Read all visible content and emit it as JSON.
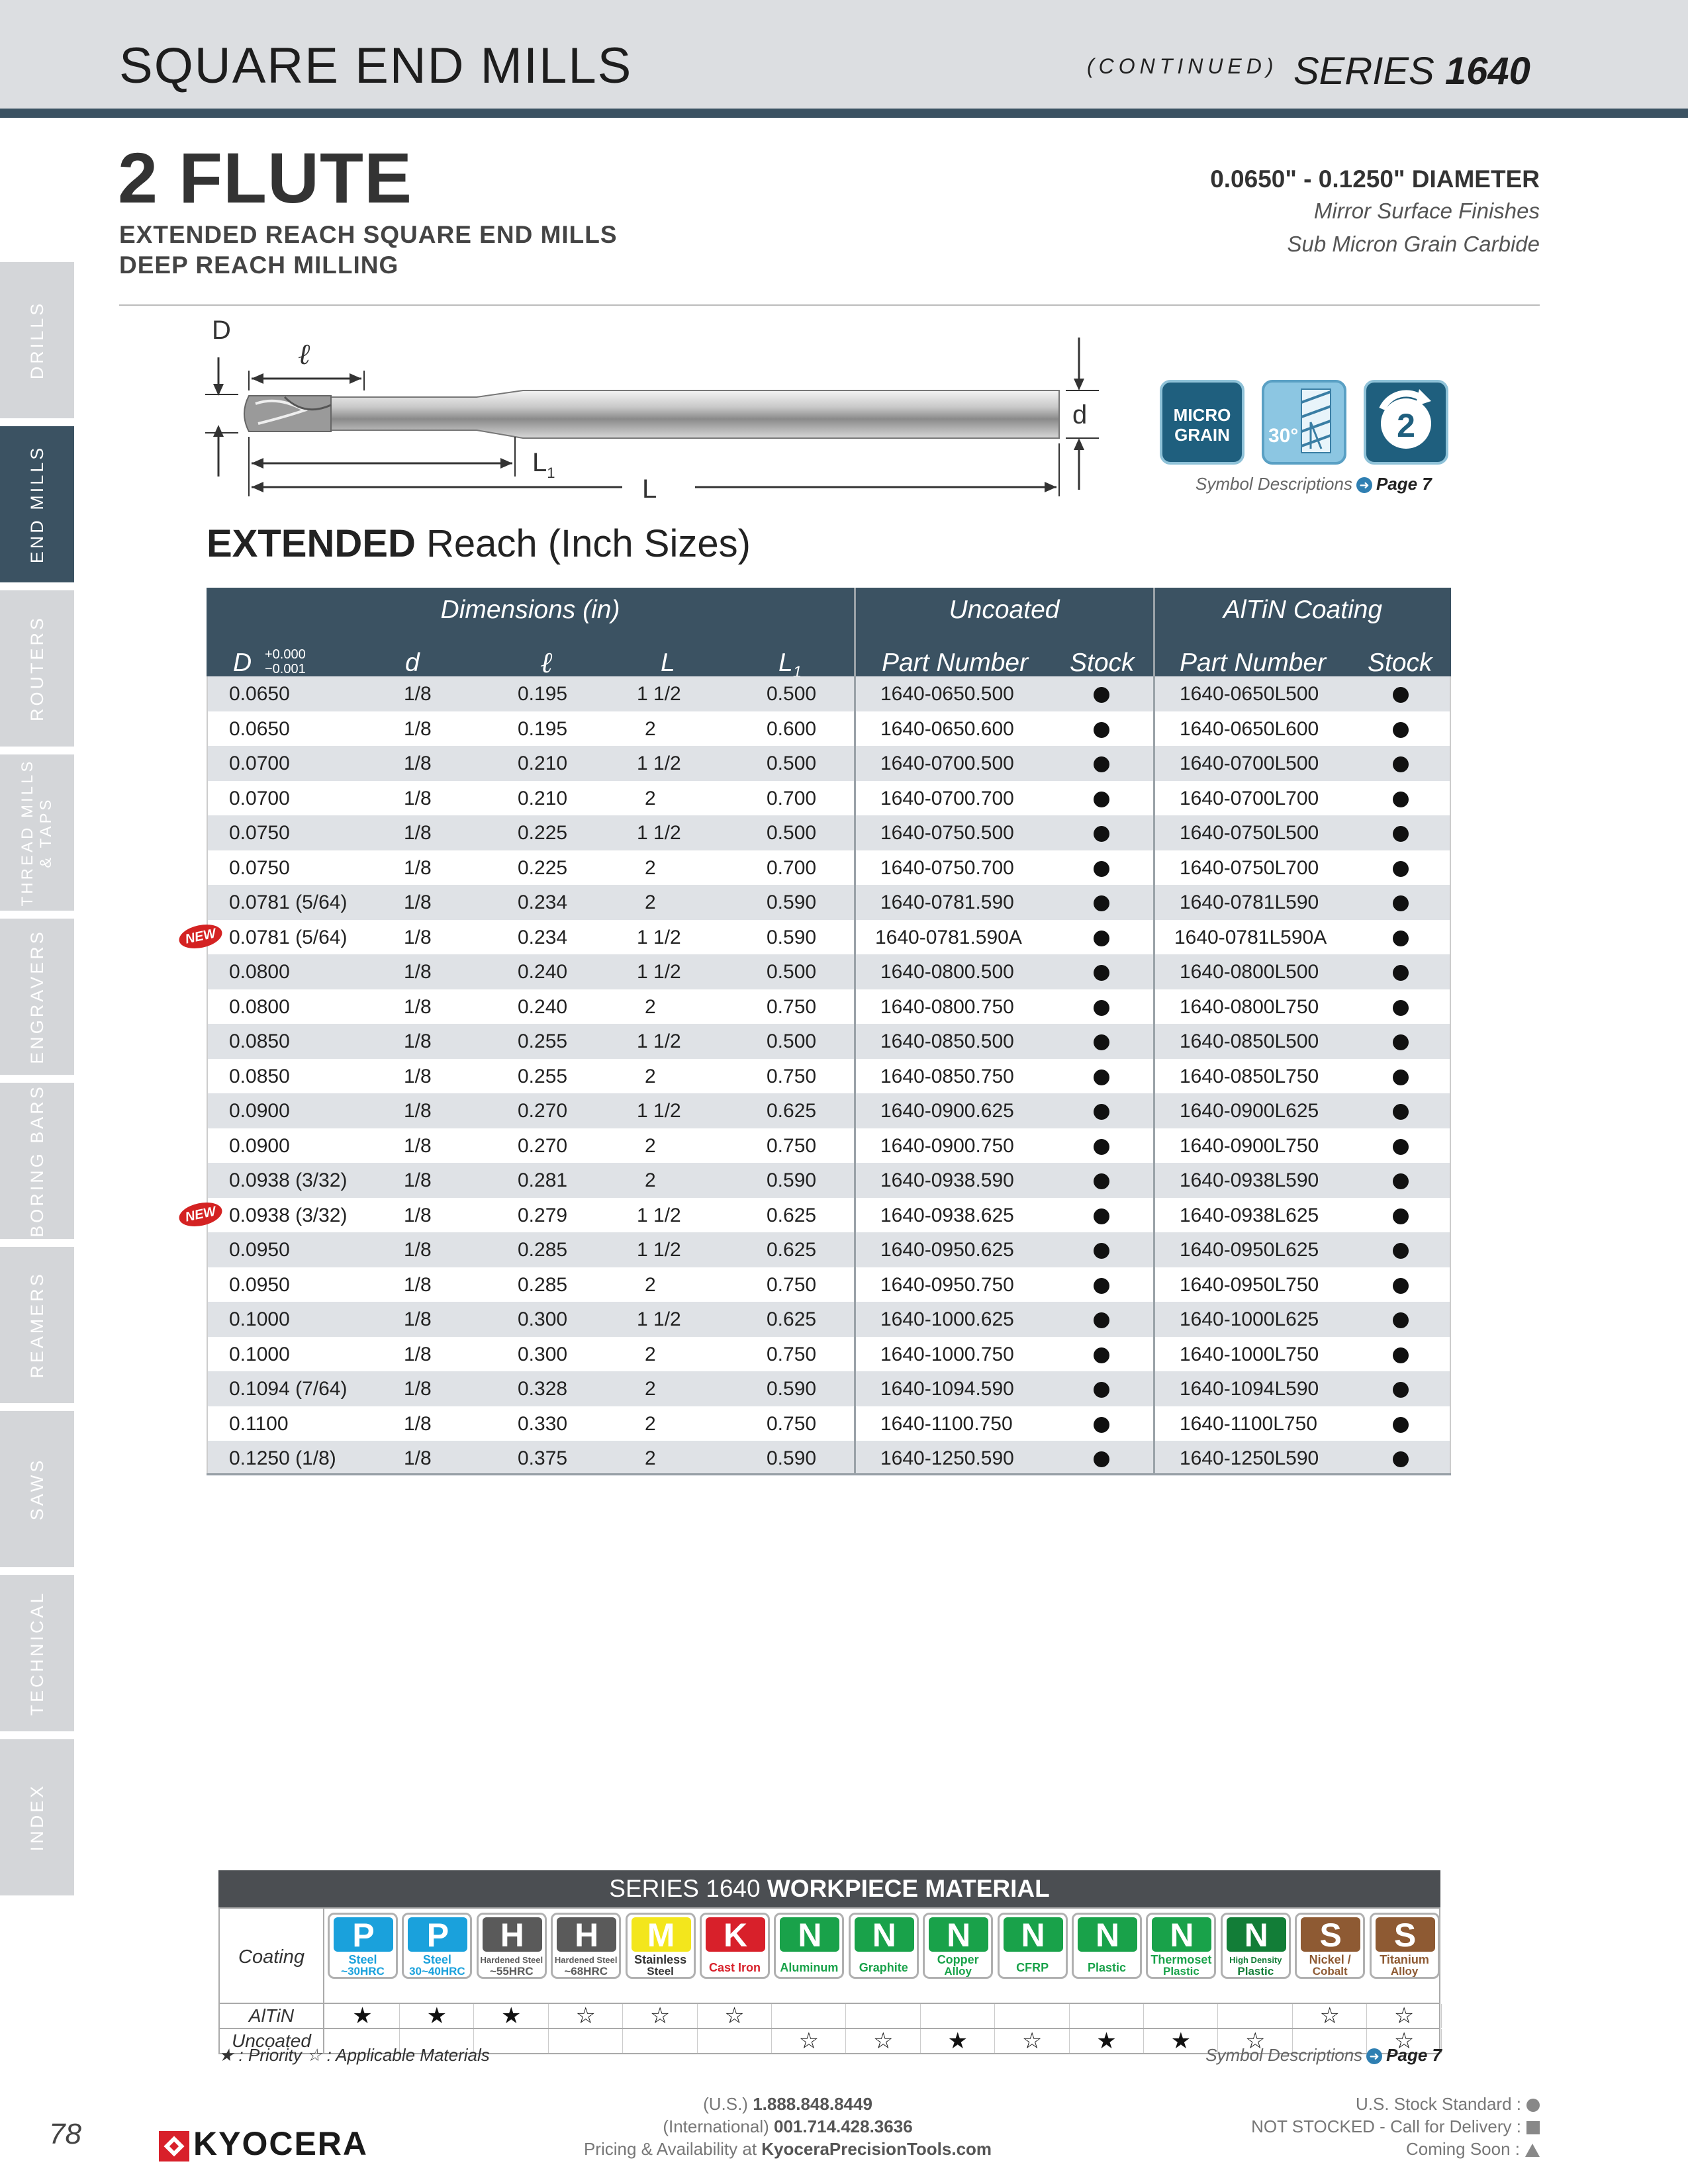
{
  "header": {
    "title": "SQUARE END MILLS",
    "continued": "(CONTINUED)",
    "series_label": "SERIES",
    "series_number": "1640"
  },
  "side_tabs": [
    {
      "label": "DRILLS",
      "active": false
    },
    {
      "label": "END MILLS",
      "active": true
    },
    {
      "label": "ROUTERS",
      "active": false
    },
    {
      "label": "THREAD MILLS & TAPS",
      "active": false
    },
    {
      "label": "ENGRAVERS",
      "active": false
    },
    {
      "label": "BORING BARS",
      "active": false
    },
    {
      "label": "REAMERS",
      "active": false
    },
    {
      "label": "SAWS",
      "active": false
    },
    {
      "label": "TECHNICAL",
      "active": false
    },
    {
      "label": "INDEX",
      "active": false
    }
  ],
  "product": {
    "flute_title": "2 FLUTE",
    "subtitle_1": "EXTENDED REACH SQUARE END MILLS",
    "subtitle_2": "DEEP REACH MILLING",
    "diameter_range": "0.0650\" - 0.1250\" DIAMETER",
    "finish_1": "Mirror Surface Finishes",
    "finish_2": "Sub Micron Grain Carbide"
  },
  "diagram": {
    "label_D": "D",
    "label_l": "ℓ",
    "label_d": "d",
    "label_L1": "L",
    "label_L1_sub": "1",
    "label_L": "L"
  },
  "badges": {
    "micro_grain_1": "MICRO",
    "micro_grain_2": "GRAIN",
    "helix": "30°",
    "flutes": "2",
    "symbol_desc": "Symbol Descriptions",
    "page_ref": "Page 7"
  },
  "table_title": {
    "bold": "EXTENDED",
    "rest": " Reach (Inch Sizes)"
  },
  "table": {
    "group_headers": [
      "Dimensions (in)",
      "Uncoated",
      "AlTiN Coating"
    ],
    "col_D": "D",
    "tol_plus": "+0.000",
    "tol_minus": "−0.001",
    "col_d": "d",
    "col_l": "ℓ",
    "col_L": "L",
    "col_L1": "L",
    "col_L1_sub": "1",
    "col_pn": "Part Number",
    "col_stock": "Stock",
    "col_pn2": "Part Number",
    "col_stock2": "Stock",
    "new_label": "NEW",
    "rows": [
      {
        "D": "0.0650",
        "d": "1/8",
        "l": "0.195",
        "L": "1 1/2",
        "L1": "0.500",
        "pn": "1640-0650.500",
        "pn2": "1640-0650L500",
        "new": false
      },
      {
        "D": "0.0650",
        "d": "1/8",
        "l": "0.195",
        "L": "2",
        "L1": "0.600",
        "pn": "1640-0650.600",
        "pn2": "1640-0650L600",
        "new": false
      },
      {
        "D": "0.0700",
        "d": "1/8",
        "l": "0.210",
        "L": "1 1/2",
        "L1": "0.500",
        "pn": "1640-0700.500",
        "pn2": "1640-0700L500",
        "new": false
      },
      {
        "D": "0.0700",
        "d": "1/8",
        "l": "0.210",
        "L": "2",
        "L1": "0.700",
        "pn": "1640-0700.700",
        "pn2": "1640-0700L700",
        "new": false
      },
      {
        "D": "0.0750",
        "d": "1/8",
        "l": "0.225",
        "L": "1 1/2",
        "L1": "0.500",
        "pn": "1640-0750.500",
        "pn2": "1640-0750L500",
        "new": false
      },
      {
        "D": "0.0750",
        "d": "1/8",
        "l": "0.225",
        "L": "2",
        "L1": "0.700",
        "pn": "1640-0750.700",
        "pn2": "1640-0750L700",
        "new": false
      },
      {
        "D": "0.0781 (5/64)",
        "d": "1/8",
        "l": "0.234",
        "L": "2",
        "L1": "0.590",
        "pn": "1640-0781.590",
        "pn2": "1640-0781L590",
        "new": false
      },
      {
        "D": "0.0781 (5/64)",
        "d": "1/8",
        "l": "0.234",
        "L": "1 1/2",
        "L1": "0.590",
        "pn": "1640-0781.590A",
        "pn2": "1640-0781L590A",
        "new": true
      },
      {
        "D": "0.0800",
        "d": "1/8",
        "l": "0.240",
        "L": "1 1/2",
        "L1": "0.500",
        "pn": "1640-0800.500",
        "pn2": "1640-0800L500",
        "new": false
      },
      {
        "D": "0.0800",
        "d": "1/8",
        "l": "0.240",
        "L": "2",
        "L1": "0.750",
        "pn": "1640-0800.750",
        "pn2": "1640-0800L750",
        "new": false
      },
      {
        "D": "0.0850",
        "d": "1/8",
        "l": "0.255",
        "L": "1 1/2",
        "L1": "0.500",
        "pn": "1640-0850.500",
        "pn2": "1640-0850L500",
        "new": false
      },
      {
        "D": "0.0850",
        "d": "1/8",
        "l": "0.255",
        "L": "2",
        "L1": "0.750",
        "pn": "1640-0850.750",
        "pn2": "1640-0850L750",
        "new": false
      },
      {
        "D": "0.0900",
        "d": "1/8",
        "l": "0.270",
        "L": "1 1/2",
        "L1": "0.625",
        "pn": "1640-0900.625",
        "pn2": "1640-0900L625",
        "new": false
      },
      {
        "D": "0.0900",
        "d": "1/8",
        "l": "0.270",
        "L": "2",
        "L1": "0.750",
        "pn": "1640-0900.750",
        "pn2": "1640-0900L750",
        "new": false
      },
      {
        "D": "0.0938 (3/32)",
        "d": "1/8",
        "l": "0.281",
        "L": "2",
        "L1": "0.590",
        "pn": "1640-0938.590",
        "pn2": "1640-0938L590",
        "new": false
      },
      {
        "D": "0.0938 (3/32)",
        "d": "1/8",
        "l": "0.279",
        "L": "1 1/2",
        "L1": "0.625",
        "pn": "1640-0938.625",
        "pn2": "1640-0938L625",
        "new": true
      },
      {
        "D": "0.0950",
        "d": "1/8",
        "l": "0.285",
        "L": "1 1/2",
        "L1": "0.625",
        "pn": "1640-0950.625",
        "pn2": "1640-0950L625",
        "new": false
      },
      {
        "D": "0.0950",
        "d": "1/8",
        "l": "0.285",
        "L": "2",
        "L1": "0.750",
        "pn": "1640-0950.750",
        "pn2": "1640-0950L750",
        "new": false
      },
      {
        "D": "0.1000",
        "d": "1/8",
        "l": "0.300",
        "L": "1 1/2",
        "L1": "0.625",
        "pn": "1640-1000.625",
        "pn2": "1640-1000L625",
        "new": false
      },
      {
        "D": "0.1000",
        "d": "1/8",
        "l": "0.300",
        "L": "2",
        "L1": "0.750",
        "pn": "1640-1000.750",
        "pn2": "1640-1000L750",
        "new": false
      },
      {
        "D": "0.1094 (7/64)",
        "d": "1/8",
        "l": "0.328",
        "L": "2",
        "L1": "0.590",
        "pn": "1640-1094.590",
        "pn2": "1640-1094L590",
        "new": false
      },
      {
        "D": "0.1100",
        "d": "1/8",
        "l": "0.330",
        "L": "2",
        "L1": "0.750",
        "pn": "1640-1100.750",
        "pn2": "1640-1100L750",
        "new": false
      },
      {
        "D": "0.1250 (1/8)",
        "d": "1/8",
        "l": "0.375",
        "L": "2",
        "L1": "0.590",
        "pn": "1640-1250.590",
        "pn2": "1640-1250L590",
        "new": false
      }
    ]
  },
  "workpiece": {
    "title_prefix": "SERIES 1640 ",
    "title_bold": "WORKPIECE MATERIAL",
    "coating_label": "Coating",
    "altin_label": "AlTiN",
    "uncoated_label": "Uncoated",
    "materials": [
      {
        "letter": "P",
        "name_1": "Steel",
        "name_2": "~30HRC",
        "color": "#1aa1dc",
        "altin": "★",
        "uncoated": ""
      },
      {
        "letter": "P",
        "name_1": "Steel",
        "name_2": "30~40HRC",
        "color": "#1aa1dc",
        "altin": "★",
        "uncoated": ""
      },
      {
        "letter": "H",
        "name_1": "Hardened Steel",
        "name_2": "~55HRC",
        "color": "#5a5a5a",
        "altin": "★",
        "uncoated": ""
      },
      {
        "letter": "H",
        "name_1": "Hardened Steel",
        "name_2": "~68HRC",
        "color": "#5a5a5a",
        "altin": "☆",
        "uncoated": ""
      },
      {
        "letter": "M",
        "name_1": "Stainless",
        "name_2": "Steel",
        "color": "#f3e61c",
        "altin": "☆",
        "uncoated": ""
      },
      {
        "letter": "K",
        "name_1": "Cast Iron",
        "name_2": "",
        "color": "#d8202a",
        "altin": "☆",
        "uncoated": ""
      },
      {
        "letter": "N",
        "name_1": "Aluminum",
        "name_2": "",
        "color": "#19a24a",
        "altin": "",
        "uncoated": "☆"
      },
      {
        "letter": "N",
        "name_1": "Graphite",
        "name_2": "",
        "color": "#19a24a",
        "altin": "",
        "uncoated": "☆"
      },
      {
        "letter": "N",
        "name_1": "Copper",
        "name_2": "Alloy",
        "color": "#19a24a",
        "altin": "",
        "uncoated": "★"
      },
      {
        "letter": "N",
        "name_1": "CFRP",
        "name_2": "",
        "color": "#19a24a",
        "altin": "",
        "uncoated": "☆"
      },
      {
        "letter": "N",
        "name_1": "Plastic",
        "name_2": "",
        "color": "#19a24a",
        "altin": "",
        "uncoated": "★"
      },
      {
        "letter": "N",
        "name_1": "Thermoset",
        "name_2": "Plastic",
        "color": "#19a24a",
        "altin": "",
        "uncoated": "★"
      },
      {
        "letter": "N",
        "name_1": "High Density",
        "name_2": "Plastic",
        "color": "#127d37",
        "altin": "",
        "uncoated": "☆"
      },
      {
        "letter": "S",
        "name_1": "Nickel /",
        "name_2": "Cobalt",
        "color": "#8e5a33",
        "altin": "☆",
        "uncoated": ""
      },
      {
        "letter": "S",
        "name_1": "Titanium",
        "name_2": "Alloy",
        "color": "#8e5a33",
        "altin": "☆",
        "uncoated": "☆"
      }
    ],
    "legend": "★ : Priority  ☆ : Applicable Materials",
    "symbol_desc": "Symbol Descriptions",
    "page_ref": "Page 7"
  },
  "footer": {
    "page_number": "78",
    "brand": "KYOCERA",
    "us_prefix": "(U.S.) ",
    "us_phone": "1.888.848.8449",
    "intl_prefix": "(International) ",
    "intl_phone": "001.714.428.3636",
    "pricing_prefix": "Pricing & Availability at ",
    "pricing_site": "KyoceraPrecisionTools.com",
    "stock_standard": "U.S. Stock Standard :",
    "not_stocked": "NOT STOCKED - Call for Delivery :",
    "coming_soon": "Coming Soon :"
  },
  "colors": {
    "accent": "#3b5262",
    "header_bg": "#dcdee1",
    "row_alt": "#dfe2e6"
  }
}
